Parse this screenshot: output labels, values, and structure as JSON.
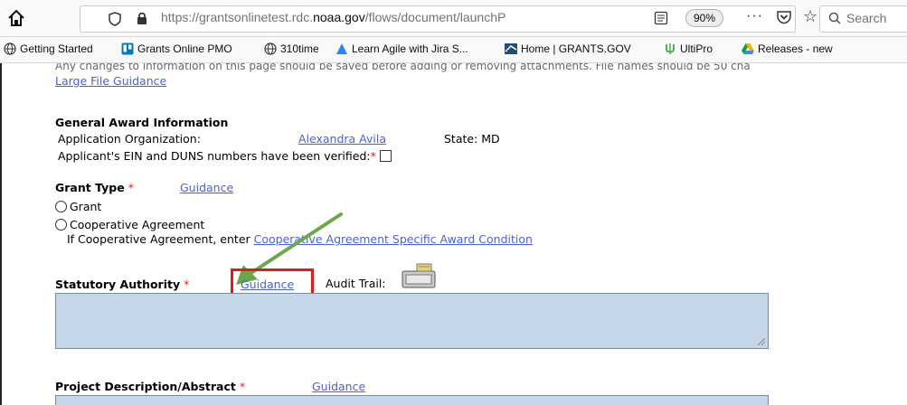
{
  "browser": {
    "url_prefix": "https://grantsonlinetest.rdc.",
    "url_domain": "noaa.gov",
    "url_suffix": "/flows/document/launchP",
    "zoom": "90%",
    "menu": "···",
    "search_placeholder": "Search"
  },
  "bookmarks": [
    {
      "label": "Getting Started",
      "icon": "globe-icon",
      "color": "#333333"
    },
    {
      "label": "Grants Online PMO",
      "icon": "trello-icon",
      "color": "#0079bf"
    },
    {
      "label": "310time",
      "icon": "globe-icon",
      "color": "#333333"
    },
    {
      "label": "Learn Agile with Jira S...",
      "icon": "jira-icon",
      "color": "#2684ff"
    },
    {
      "label": "Home | GRANTS.GOV",
      "icon": "grants-icon",
      "color": "#1f4e79"
    },
    {
      "label": "UltiPro",
      "icon": "ultipro-icon",
      "color": "#4caf50"
    },
    {
      "label": "Releases - new",
      "icon": "drive-icon",
      "color": "#f4b400"
    }
  ],
  "page": {
    "cut_text": "Any changes to information on this page should be saved before adding or removing attachments. File names should be 50 cha",
    "large_file_link": "Large File Guidance",
    "general_heading": "General Award Information",
    "app_org_label": "Application Organization:",
    "app_org_value": "Alexandra Avila",
    "state_label": "State: MD",
    "ein_label": "Applicant's EIN and DUNS numbers have been verified:",
    "required_mark": "*",
    "grant_type_label": "Grant Type",
    "guidance": "Guidance",
    "option_grant": "Grant",
    "option_coop": "Cooperative Agreement",
    "coop_note": "If Cooperative Agreement, enter",
    "coop_link": "Cooperative Agreement Specific Award Condition",
    "statutory_label": "Statutory Authority",
    "audit_trail_label": "Audit Trail:",
    "project_label": "Project Description/Abstract"
  },
  "colors": {
    "link": "#4b5fd6",
    "required": "#e02020",
    "textarea_bg": "#c7d7ea",
    "highlight_box": "#e01b1b",
    "arrow": "#6aa84f"
  }
}
